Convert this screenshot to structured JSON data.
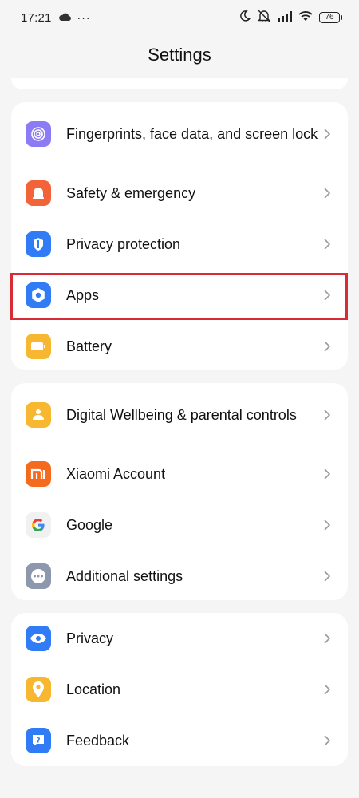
{
  "status": {
    "time": "17:21",
    "overflow": "···",
    "battery": "76",
    "icons": [
      "cloud-icon",
      "moon-icon",
      "muted-bell-icon",
      "signal-icon",
      "wifi-icon",
      "battery-icon"
    ]
  },
  "header": {
    "title": "Settings"
  },
  "groups": [
    {
      "items": [
        {
          "label": "Fingerprints, face data, and screen lock",
          "icon": "fingerprint-icon",
          "color": "#8b7cf6"
        },
        {
          "label": "Safety & emergency",
          "icon": "alarm-icon",
          "color": "#f2633a"
        },
        {
          "label": "Privacy protection",
          "icon": "shield-icon",
          "color": "#2f7cf6"
        },
        {
          "label": "Apps",
          "icon": "apps-gear-icon",
          "color": "#2f7cf6"
        },
        {
          "label": "Battery",
          "icon": "battery-icon",
          "color": "#f7b731"
        }
      ]
    },
    {
      "items": [
        {
          "label": "Digital Wellbeing & parental controls",
          "icon": "wellbeing-icon",
          "color": "#f7b731"
        },
        {
          "label": "Xiaomi Account",
          "icon": "mi-logo-icon",
          "color": "#f56b1e"
        },
        {
          "label": "Google",
          "icon": "google-logo-icon",
          "color": "#ffffff"
        },
        {
          "label": "Additional settings",
          "icon": "more-dots-icon",
          "color": "#8e98ad"
        }
      ]
    },
    {
      "items": [
        {
          "label": "Privacy",
          "icon": "eye-icon",
          "color": "#2f7cf6"
        },
        {
          "label": "Location",
          "icon": "location-pin-icon",
          "color": "#f7b731"
        },
        {
          "label": "Feedback",
          "icon": "feedback-icon",
          "color": "#2f7cf6"
        }
      ]
    }
  ],
  "highlight": {
    "target": "Apps",
    "color": "#d92b36"
  }
}
